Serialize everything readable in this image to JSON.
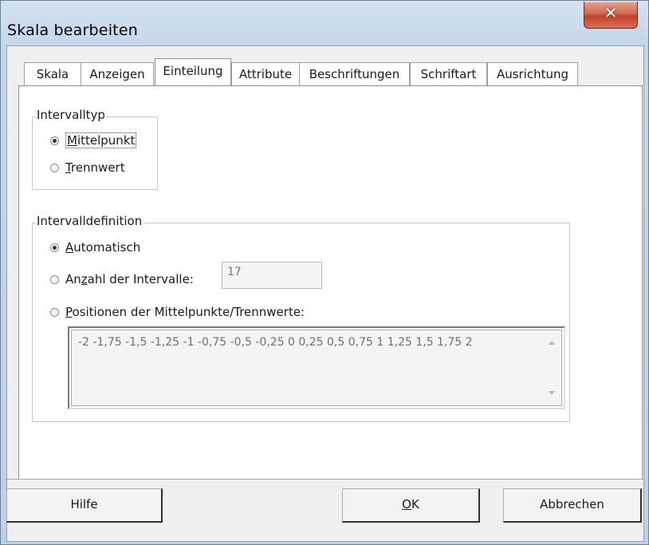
{
  "window": {
    "title": "Skala bearbeiten",
    "close_glyph": "✕"
  },
  "tabs": [
    {
      "label": "Skala",
      "active": false
    },
    {
      "label": "Anzeigen",
      "active": false
    },
    {
      "label": "Einteilung",
      "active": true
    },
    {
      "label": "Attribute",
      "active": false
    },
    {
      "label": "Beschriftungen",
      "active": false
    },
    {
      "label": "Schriftart",
      "active": false
    },
    {
      "label": "Ausrichtung",
      "active": false
    }
  ],
  "intervalltyp": {
    "title": "Intervalltyp",
    "options": [
      {
        "mnemonic": "M",
        "rest": "ittelpunkt",
        "checked": true
      },
      {
        "mnemonic": "T",
        "rest": "rennwert",
        "checked": false
      }
    ]
  },
  "intervalldefinition": {
    "title": "Intervalldefinition",
    "auto": {
      "mnemonic": "A",
      "rest": "utomatisch",
      "checked": true
    },
    "anzahl": {
      "pre": "An",
      "mnemonic": "z",
      "rest": "ahl der Intervalle:",
      "checked": false,
      "value": "17"
    },
    "positionen": {
      "mnemonic": "P",
      "rest": "ositionen der Mittelpunkte/Trennwerte:",
      "checked": false,
      "value": "-2 -1,75 -1,5 -1,25 -1 -0,75 -0,5 -0,25 0 0,25 0,5 0,75 1 1,25 1,5 1,75 2"
    }
  },
  "buttons": {
    "help": "Hilfe",
    "ok_mnemonic": "O",
    "ok_rest": "K",
    "cancel": "Abbrechen"
  }
}
